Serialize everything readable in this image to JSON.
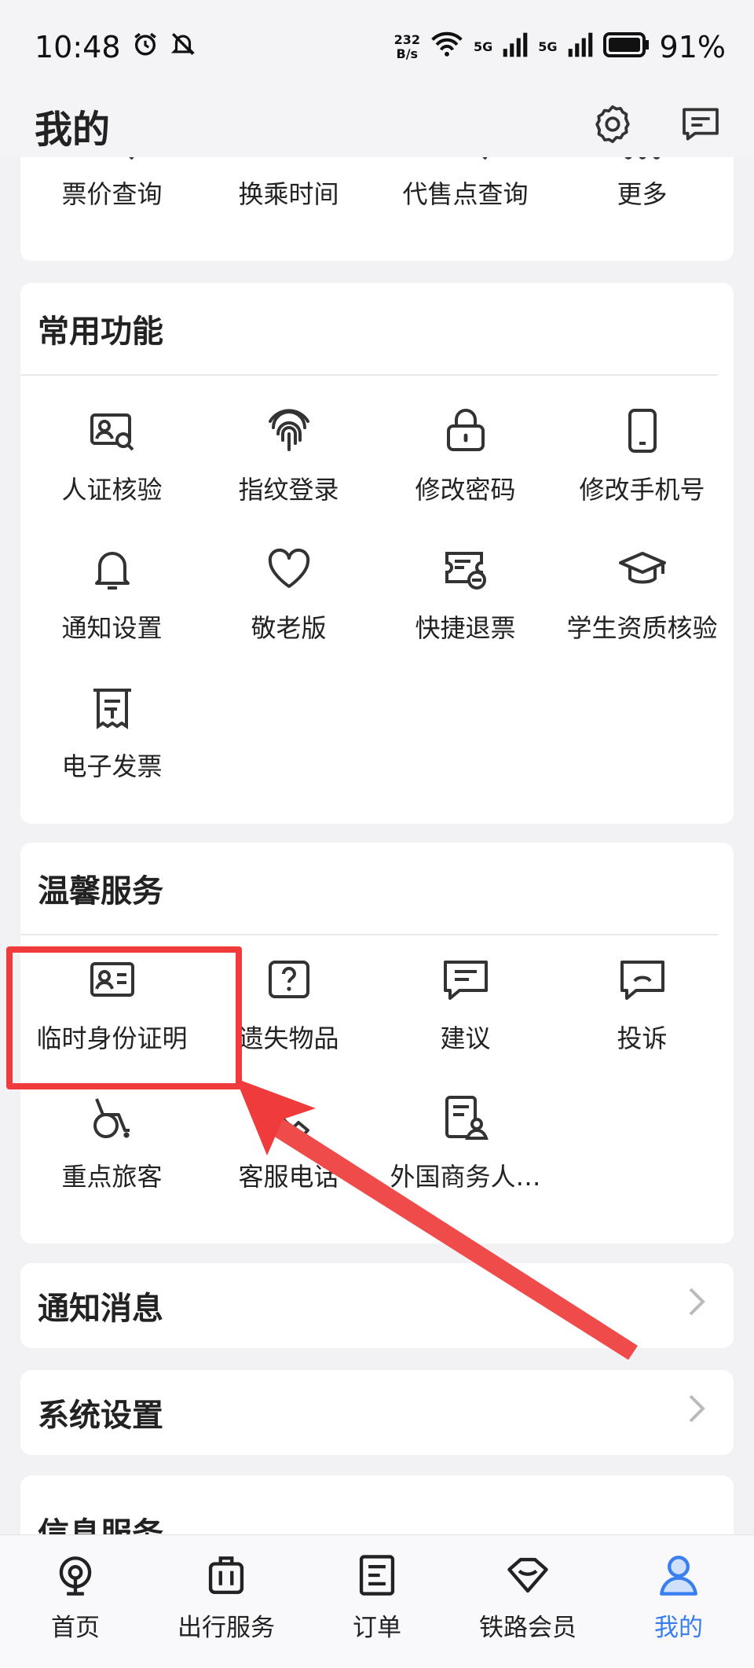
{
  "status": {
    "time": "10:48",
    "speed_value": "232",
    "speed_unit": "B/s",
    "net1": "5G",
    "net2": "5G",
    "battery": "91%"
  },
  "header": {
    "title": "我的"
  },
  "top_items": [
    {
      "label": "票价查询",
      "icon": "search-doc-icon"
    },
    {
      "label": "换乘时间",
      "icon": "transfer-icon"
    },
    {
      "label": "代售点查询",
      "icon": "search-doc-icon"
    },
    {
      "label": "更多",
      "icon": "more-dots-icon"
    }
  ],
  "common": {
    "title": "常用功能",
    "items": [
      {
        "label": "人证核验",
        "icon": "id-verify-icon"
      },
      {
        "label": "指纹登录",
        "icon": "fingerprint-icon"
      },
      {
        "label": "修改密码",
        "icon": "lock-icon"
      },
      {
        "label": "修改手机号",
        "icon": "phone-icon"
      },
      {
        "label": "通知设置",
        "icon": "bell-icon"
      },
      {
        "label": "敬老版",
        "icon": "heart-icon"
      },
      {
        "label": "快捷退票",
        "icon": "refund-ticket-icon"
      },
      {
        "label": "学生资质核验",
        "icon": "graduation-cap-icon"
      },
      {
        "label": "电子发票",
        "icon": "invoice-icon"
      }
    ]
  },
  "warm": {
    "title": "温馨服务",
    "items": [
      {
        "label": "临时身份证明",
        "icon": "id-card-icon"
      },
      {
        "label": "遗失物品",
        "icon": "lost-item-icon"
      },
      {
        "label": "建议",
        "icon": "suggestion-icon"
      },
      {
        "label": "投诉",
        "icon": "complaint-icon"
      },
      {
        "label": "重点旅客",
        "icon": "wheelchair-icon"
      },
      {
        "label": "客服电话",
        "icon": "phone-call-icon"
      },
      {
        "label": "外国商务人…",
        "icon": "foreign-business-icon"
      }
    ]
  },
  "rows": {
    "notify": "通知消息",
    "system": "系统设置",
    "info": "信息服务"
  },
  "nav": [
    {
      "label": "首页",
      "icon": "home-train-icon"
    },
    {
      "label": "出行服务",
      "icon": "luggage-icon"
    },
    {
      "label": "订单",
      "icon": "order-icon"
    },
    {
      "label": "铁路会员",
      "icon": "diamond-icon"
    },
    {
      "label": "我的",
      "icon": "user-icon"
    }
  ],
  "colors": {
    "accent": "#3a7ff0",
    "annotation": "#ef3b3b",
    "background": "#f2f2f4"
  }
}
